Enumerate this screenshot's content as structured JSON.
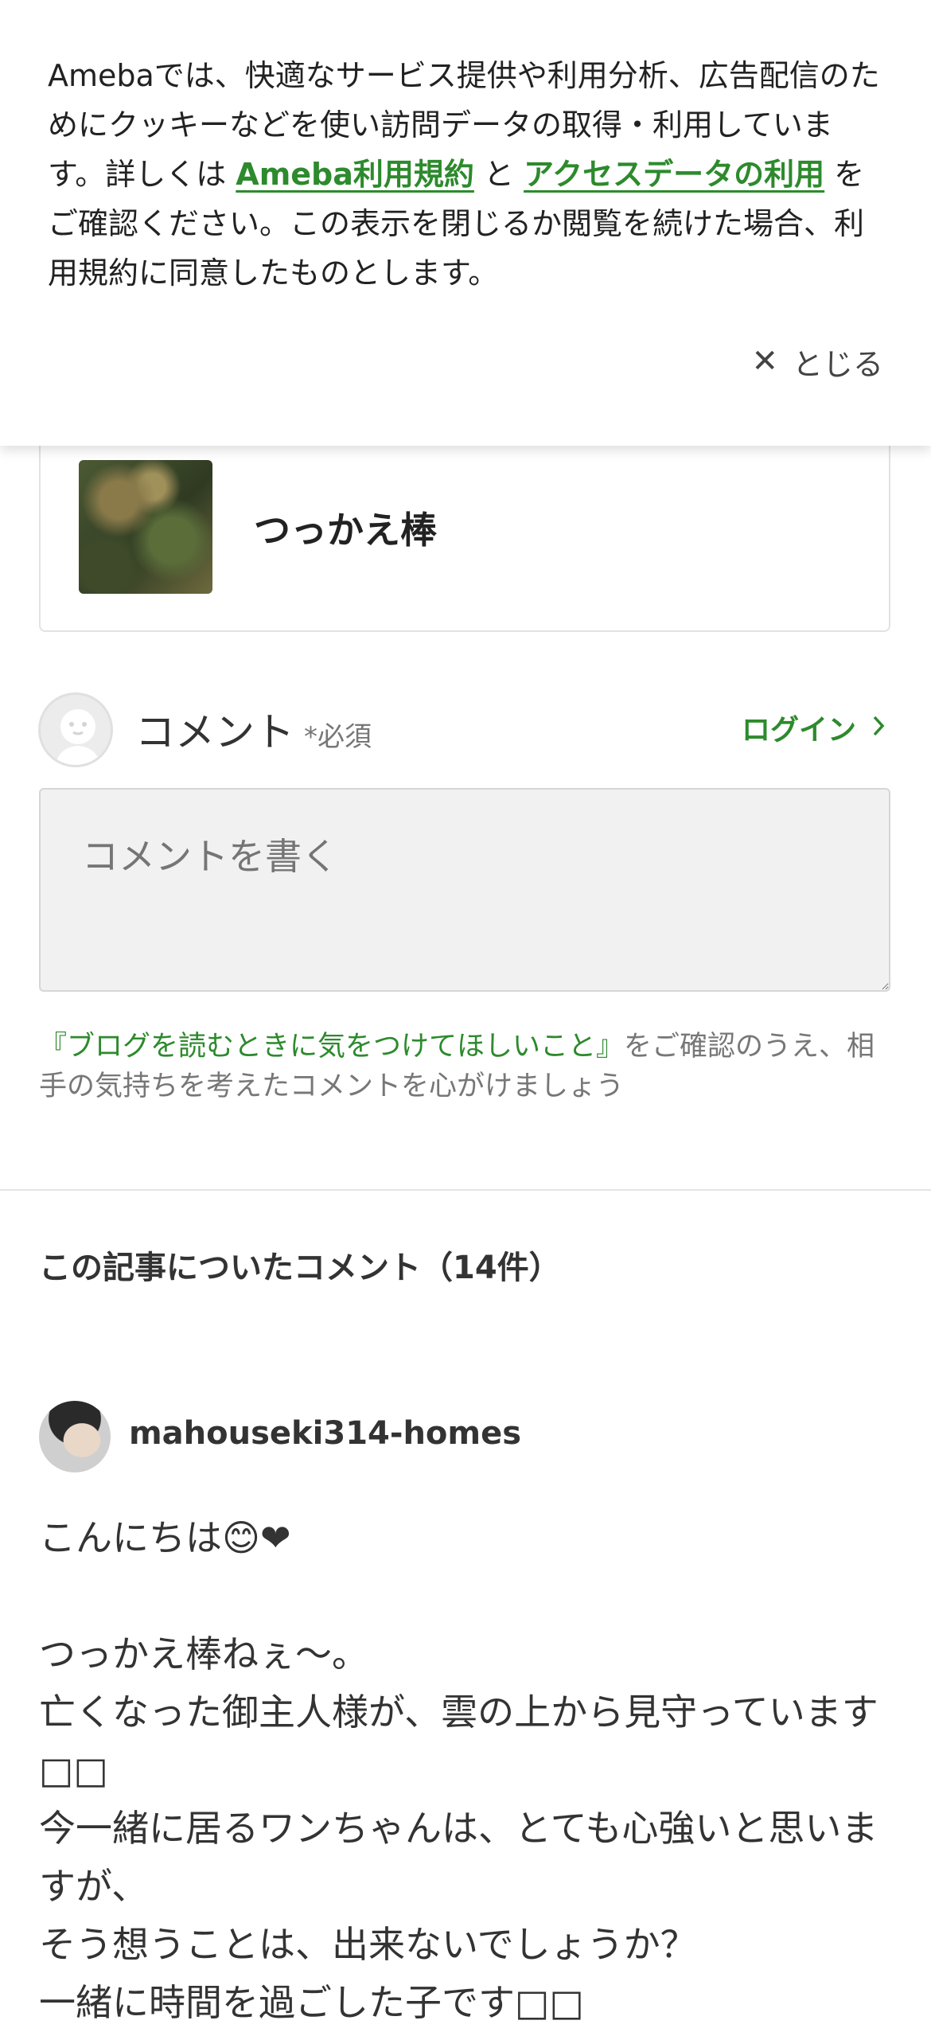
{
  "cookie_banner": {
    "text_before": "Amebaでは、快適なサービス提供や利用分析、広告配信のためにクッキーなどを使い訪問データの取得・利用しています。詳しくは ",
    "terms_link": "Ameba利用規約",
    "conjunction": " と ",
    "access_link": "アクセスデータの利用",
    "text_after": " をご確認ください。この表示を閉じるか閲覧を続けた場合、利用規約に同意したものとします。",
    "close_label": "とじる"
  },
  "reblog_card": {
    "title": "つっかえ棒"
  },
  "comment_form": {
    "heading": "コメント",
    "required": "*必須",
    "login_label": "ログイン",
    "placeholder": "コメントを書く",
    "notice_link": "『ブログを読むときに気をつけてほしいこと』",
    "notice_text": "をご確認のうえ、相手の気持ちを考えたコメントを心がけましょう"
  },
  "comments_section": {
    "heading": "この記事についたコメント（14件）",
    "comments": [
      {
        "author": "mahouseki314-homes",
        "lines": [
          "こんにちは😊❤",
          "",
          "つっかえ棒ねぇ〜。",
          "亡くなった御主人様が、雲の上から見守っています□□",
          "今一緒に居るワンちゃんは、とても心強いと思いますが、",
          "そう想うことは、出来ないでしょうか？",
          "一緒に時間を過ごした子です□□"
        ]
      }
    ]
  },
  "colors": {
    "accent_green": "#2d8a2d",
    "text": "#333333",
    "muted": "#777777"
  }
}
